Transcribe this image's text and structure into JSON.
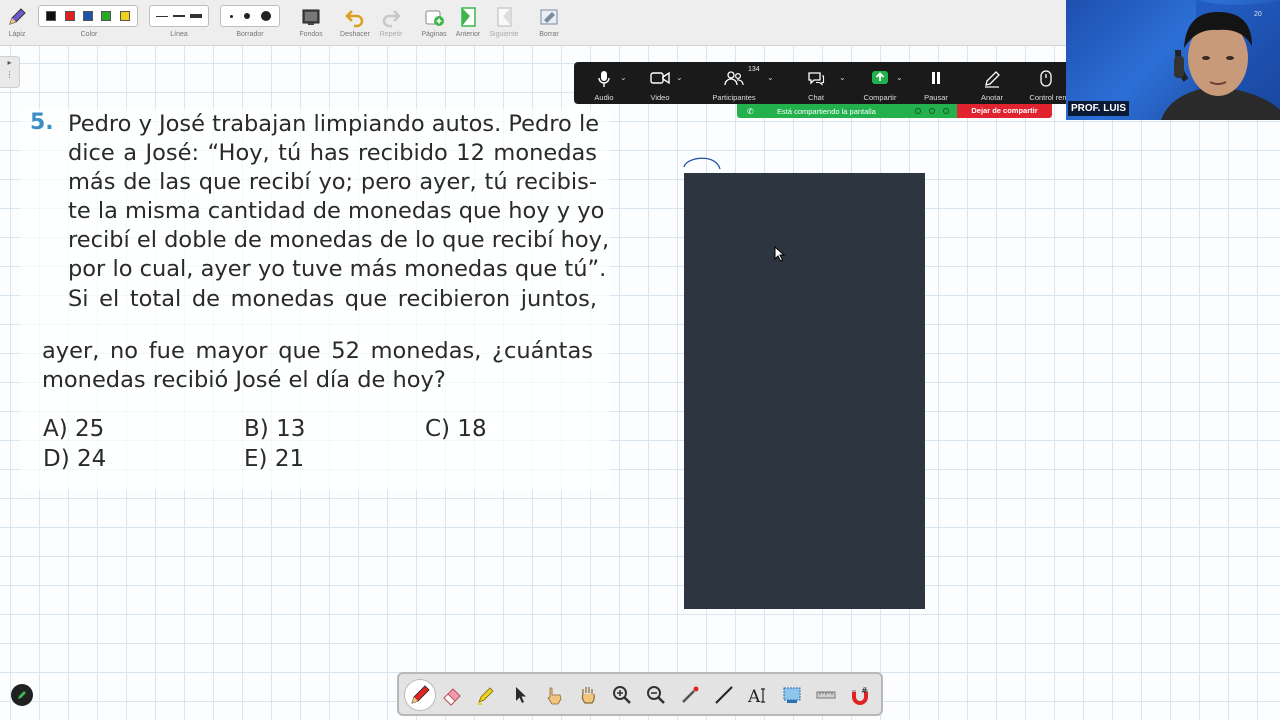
{
  "toolbar": {
    "tools": [
      {
        "id": "lapiz",
        "label": "Lápiz",
        "icon": "pencil-icon"
      },
      {
        "id": "color",
        "label": "Color",
        "icon": "color-swatches"
      },
      {
        "id": "linea",
        "label": "Línea",
        "icon": "line-width"
      },
      {
        "id": "borrador",
        "label": "Borrador",
        "icon": "eraser-size"
      },
      {
        "id": "fondos",
        "label": "Fondos",
        "icon": "background-icon"
      },
      {
        "id": "deshacer",
        "label": "Deshacer",
        "icon": "undo-icon"
      },
      {
        "id": "repetir",
        "label": "Repetir",
        "icon": "redo-icon"
      },
      {
        "id": "paginas",
        "label": "Páginas",
        "icon": "pages-icon"
      },
      {
        "id": "anterior",
        "label": "Anterior",
        "icon": "previous-page-icon"
      },
      {
        "id": "siguiente",
        "label": "Siguiente",
        "icon": "next-page-icon"
      },
      {
        "id": "borrar",
        "label": "Borrar",
        "icon": "clear-icon"
      }
    ],
    "colors": [
      "#111111",
      "#e02020",
      "#2255aa",
      "#22aa22",
      "#f0d020"
    ]
  },
  "meeting": {
    "buttons": [
      {
        "label": "Audio",
        "icon": "microphone-icon"
      },
      {
        "label": "Video",
        "icon": "video-camera-icon"
      },
      {
        "label": "Participantes",
        "icon": "participants-icon"
      },
      {
        "label": "Chat",
        "icon": "chat-icon"
      },
      {
        "label": "Compartir",
        "icon": "share-screen-icon"
      },
      {
        "label": "Pausar",
        "icon": "pause-icon"
      },
      {
        "label": "Anotar",
        "icon": "annotate-icon"
      },
      {
        "label": "Control rem",
        "icon": "remote-control-icon"
      }
    ],
    "participant_count": "134",
    "share_status": "Está compartiendo la pantalla",
    "stop_share": "Dejar de compartir",
    "accent": "#22b14c",
    "stop_color": "#e0232e"
  },
  "webcam": {
    "name": "PROF. LUIS"
  },
  "problem": {
    "number": "5.",
    "lines": [
      "Pedro y José trabajan limpiando autos. Pedro le",
      "dice a José: “Hoy, tú has recibido 12 monedas",
      "más de las que recibí yo; pero ayer, tú recibis-",
      "te la misma cantidad de monedas que hoy y yo",
      "recibí el doble de monedas de lo que recibí hoy,",
      "por lo cual, ayer yo tuve más monedas que tú”.",
      "Si el total de monedas que recibieron juntos,"
    ],
    "continuation": [
      "ayer, no fue mayor que 52 monedas, ¿cuántas",
      "monedas recibió José el día de hoy?"
    ],
    "options": [
      {
        "letter": "A)",
        "value": "25"
      },
      {
        "letter": "B)",
        "value": "13"
      },
      {
        "letter": "C)",
        "value": "18"
      },
      {
        "letter": "D)",
        "value": "24"
      },
      {
        "letter": "E)",
        "value": "21"
      }
    ]
  },
  "drawing_tools": [
    "pen-icon",
    "eraser-icon",
    "highlighter-icon",
    "select-arrow-icon",
    "pointer-hand-icon",
    "pan-hand-icon",
    "zoom-in-icon",
    "zoom-out-icon",
    "laser-pointer-icon",
    "line-icon",
    "text-icon",
    "screen-capture-icon",
    "ruler-icon",
    "magnet-icon"
  ]
}
